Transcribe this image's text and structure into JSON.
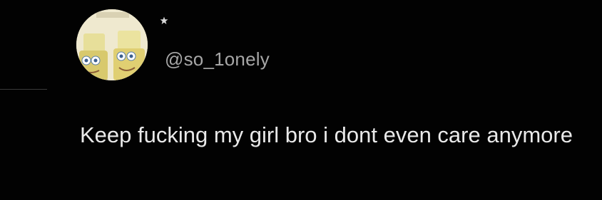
{
  "post": {
    "handle": "@so_1onely",
    "text": "Keep fucking my girl bro i dont even care anymore",
    "avatar": {
      "description_icon": "avatar-sponge-characters",
      "background_color": "#f2efd6"
    },
    "status_dot_icon": "star-icon"
  },
  "colors": {
    "background": "#020202",
    "handle_text": "#a7a7a7",
    "body_text": "#e9e9e9"
  }
}
